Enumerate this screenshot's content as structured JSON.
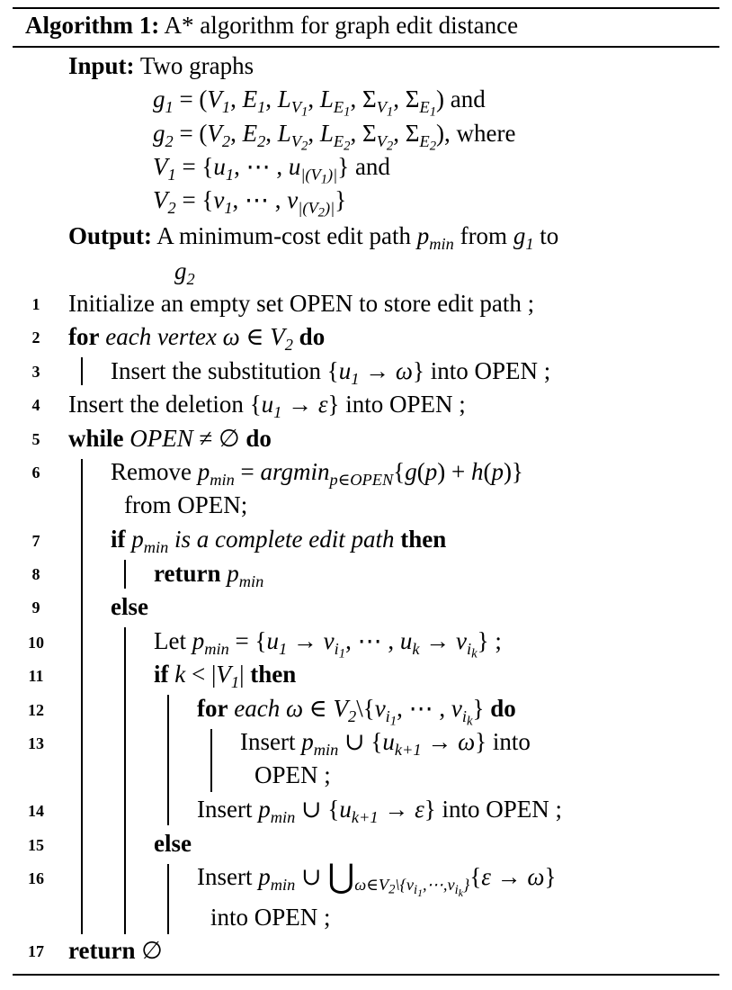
{
  "caption": {
    "label": "Algorithm 1:",
    "title": "A* algorithm for graph edit distance"
  },
  "input": {
    "label": "Input:",
    "lead": "Two graphs",
    "g1": "g₁ = (V₁, E₁, L_{V₁}, L_{E₁}, Σ_{V₁}, Σ_{E₁}) and",
    "g2": "g₂ = (V₂, E₂, L_{V₂}, L_{E₂}, Σ_{V₂}, Σ_{E₂}), where",
    "v1": "V₁ = {u₁, ⋯ , u_{|(V₁)|}} and",
    "v2": "V₂ = {v₁, ⋯ , v_{|(V₂)|}}"
  },
  "output": {
    "label": "Output:",
    "text": "A minimum-cost edit path p_min from g₁ to g₂"
  },
  "lines": [
    {
      "no": "1",
      "text": "Initialize an empty set OPEN to store edit path ;"
    },
    {
      "no": "2",
      "text": "for each vertex ω ∈ V₂ do"
    },
    {
      "no": "3",
      "text": "Insert the substitution {u₁ → ω} into OPEN ;"
    },
    {
      "no": "4",
      "text": "Insert the deletion {u₁ → ε} into OPEN ;"
    },
    {
      "no": "5",
      "text": "while OPEN ≠ ∅ do"
    },
    {
      "no": "6",
      "text": "Remove p_min = argmin_{p∈OPEN}{g(p) + h(p)} from OPEN;"
    },
    {
      "no": "7",
      "text": "if p_min is a complete edit path then"
    },
    {
      "no": "8",
      "text": "return p_min"
    },
    {
      "no": "9",
      "text": "else"
    },
    {
      "no": "10",
      "text": "Let p_min = {u₁ → v_{i₁}, ⋯ , u_k → v_{i_k}} ;"
    },
    {
      "no": "11",
      "text": "if k < |V₁| then"
    },
    {
      "no": "12",
      "text": "for each ω ∈ V₂\\{v_{i₁}, ⋯ , v_{i_k}} do"
    },
    {
      "no": "13",
      "text": "Insert p_min ∪ {u_{k+1} → ω} into OPEN ;"
    },
    {
      "no": "14",
      "text": "Insert p_min ∪ {u_{k+1} → ε} into OPEN ;"
    },
    {
      "no": "15",
      "text": "else"
    },
    {
      "no": "16",
      "text": "Insert p_min ∪ ⋃_{ω∈V₂\\{v_{i₁},⋯,v_{i_k}}} {ε → ω} into OPEN ;"
    },
    {
      "no": "17",
      "text": "return ∅"
    }
  ],
  "words": {
    "and": "and",
    "where": "where",
    "from": "from",
    "to": "to",
    "for": "for",
    "do": "do",
    "while": "while",
    "if": "if",
    "then": "then",
    "else": "else",
    "return": "return",
    "open": "OPEN",
    "into_open_semi": "into OPEN ;",
    "into": "into",
    "open_semi": "OPEN ;",
    "from_open": "from OPEN;",
    "each_vertex": "each vertex",
    "each": "each",
    "remove": "Remove",
    "let": "Let",
    "insert": "Insert",
    "insert_substitution": "Insert the substitution",
    "insert_deletion": "Insert the deletion",
    "initialize": "Initialize an empty set OPEN to store edit path ;",
    "complete_path": "is a complete edit path",
    "output_text": "A minimum-cost edit path",
    "argmin": "argmin"
  }
}
